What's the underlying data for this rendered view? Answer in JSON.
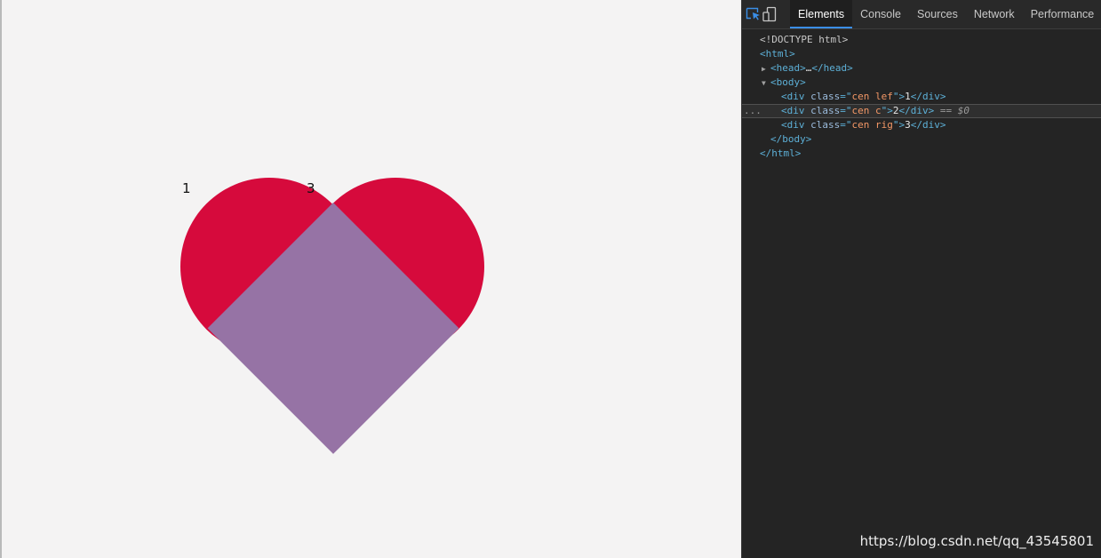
{
  "page": {
    "labels": [
      "1",
      "3"
    ],
    "colors": {
      "lobe": "#d60a3c",
      "diamond": "#9673a5",
      "background": "#f4f3f3"
    }
  },
  "devtools": {
    "tabs": [
      "Elements",
      "Console",
      "Sources",
      "Network",
      "Performance"
    ],
    "active_tab": "Elements",
    "icons": [
      "inspect-element-icon",
      "device-toolbar-icon"
    ],
    "tree": {
      "doctype": "<!DOCTYPE html>",
      "html_open": "<html>",
      "head_open": "<head>",
      "head_ellipsis": "…",
      "head_close": "</head>",
      "body_open": "<body>",
      "divs": [
        {
          "class": "cen lef",
          "text": "1"
        },
        {
          "class": "cen c",
          "text": "2"
        },
        {
          "class": "cen rig",
          "text": "3"
        }
      ],
      "selected_marker": "== $0",
      "body_close": "</body>",
      "html_close": "</html>",
      "row_ellipsis": "..."
    }
  },
  "watermark": "https://blog.csdn.net/qq_43545801"
}
